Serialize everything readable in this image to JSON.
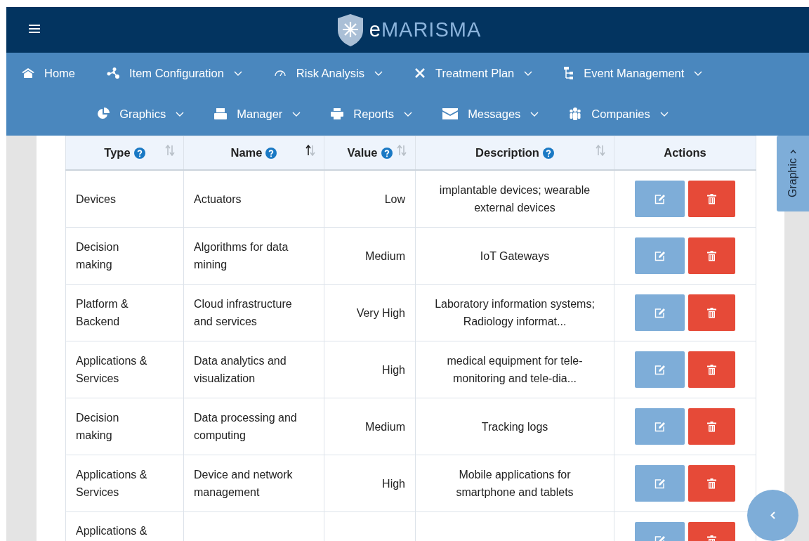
{
  "header": {
    "logo": "eMARISMA"
  },
  "nav_rows": [
    [
      {
        "label": "Home",
        "kind": "home",
        "dropdown": false
      },
      {
        "label": "Item Configuration",
        "kind": "nodes",
        "dropdown": true
      },
      {
        "label": "Risk Analysis",
        "kind": "gauge",
        "dropdown": true
      },
      {
        "label": "Treatment Plan",
        "kind": "tools",
        "dropdown": true
      },
      {
        "label": "Event Management",
        "kind": "tree",
        "dropdown": true
      }
    ],
    [
      {
        "label": "Graphics",
        "kind": "pie",
        "dropdown": true
      },
      {
        "label": "Manager",
        "kind": "tray",
        "dropdown": true
      },
      {
        "label": "Reports",
        "kind": "printer",
        "dropdown": true
      },
      {
        "label": "Messages",
        "kind": "mail",
        "dropdown": true
      },
      {
        "label": "Companies",
        "kind": "people",
        "dropdown": true
      }
    ]
  ],
  "table": {
    "columns": [
      {
        "label": "Type",
        "help": true,
        "sorted": false
      },
      {
        "label": "Name",
        "help": true,
        "sorted": true
      },
      {
        "label": "Value",
        "help": true,
        "sorted": false
      },
      {
        "label": "Description",
        "help": true,
        "sorted": false
      },
      {
        "label": "Actions",
        "help": false
      }
    ],
    "rows": [
      {
        "cells": [
          "Devices",
          "Actuators",
          "Low",
          "implantable devices; wearable external devices"
        ]
      },
      {
        "cells": [
          "Decision making",
          "Algorithms for data mining",
          "Medium",
          "IoT Gateways"
        ]
      },
      {
        "cells": [
          "Platform & Backend",
          "Cloud infrastructure and services",
          "Very High",
          "Laboratory information systems; Radiology informat..."
        ]
      },
      {
        "cells": [
          "Applications & Services",
          "Data analytics and visualization",
          "High",
          "medical equipment for tele-monitoring and tele-dia..."
        ]
      },
      {
        "cells": [
          "Decision making",
          "Data processing and computing",
          "Medium",
          "Tracking logs"
        ]
      },
      {
        "cells": [
          "Applications & Services",
          "Device and network management",
          "High",
          "Mobile applications for smartphone and tablets"
        ]
      },
      {
        "cells": [
          "Applications &"
        ]
      }
    ]
  },
  "side_tab": {
    "label": "Graphic"
  }
}
